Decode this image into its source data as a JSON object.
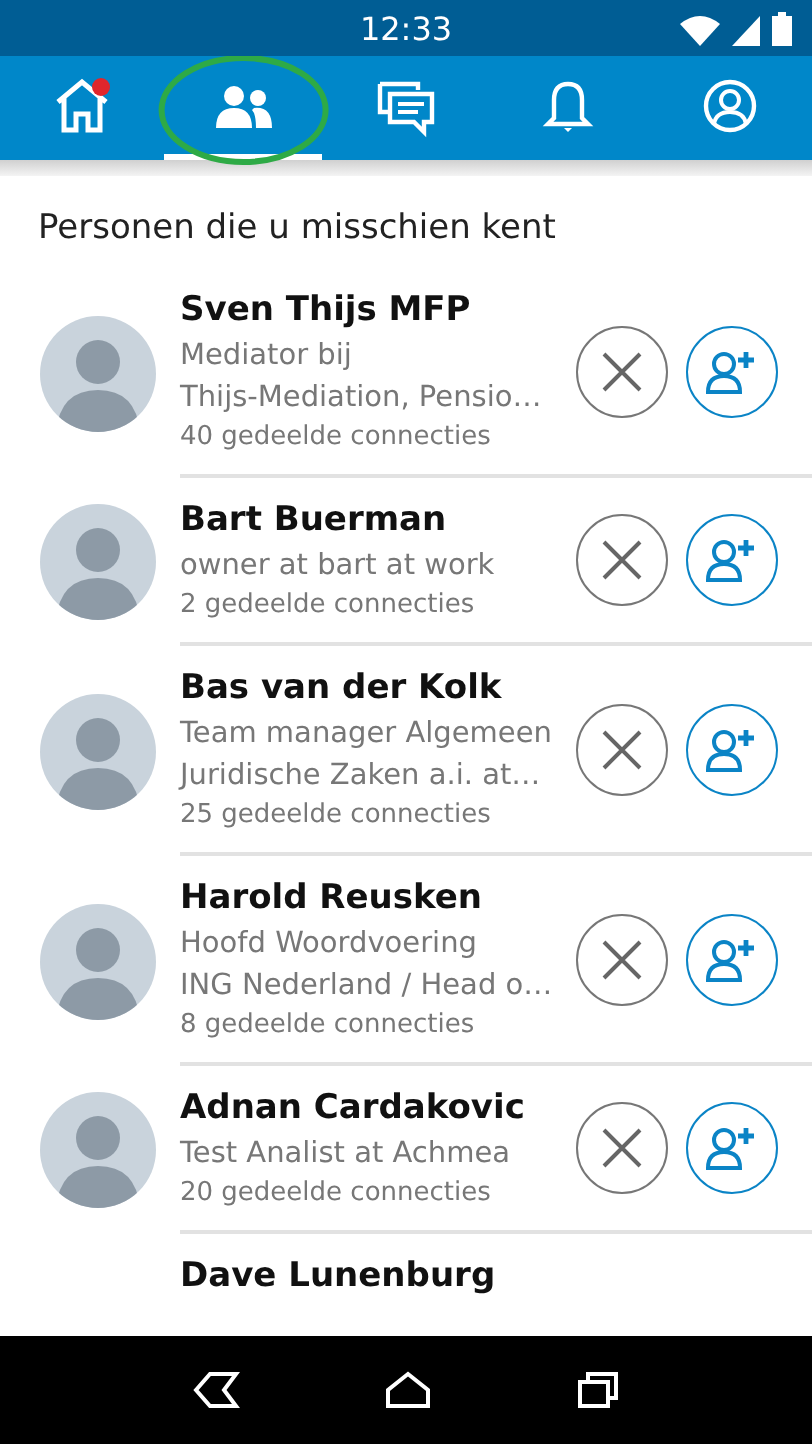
{
  "status_bar": {
    "time": "12:33"
  },
  "tabs": [
    {
      "kind": "home",
      "selected": false,
      "badge": true,
      "circled": false
    },
    {
      "kind": "people",
      "selected": true,
      "badge": false,
      "circled": true
    },
    {
      "kind": "messages",
      "selected": false,
      "badge": false,
      "circled": false
    },
    {
      "kind": "bell",
      "selected": false,
      "badge": false,
      "circled": false
    },
    {
      "kind": "profile",
      "selected": false,
      "badge": false,
      "circled": false
    }
  ],
  "heading": "Personen die u misschien kent",
  "people": [
    {
      "name": "Sven Thijs MFP",
      "headline": [
        "Mediator bij",
        "Thijs-Mediation, Pensio…"
      ],
      "connections": "40 gedeelde connecties"
    },
    {
      "name": "Bart Buerman",
      "headline": [
        "owner at bart at work"
      ],
      "connections": "2 gedeelde connecties"
    },
    {
      "name": "Bas van der Kolk",
      "headline": [
        "Team manager Algemeen",
        "Juridische Zaken a.i. at…"
      ],
      "connections": "25 gedeelde connecties"
    },
    {
      "name": "Harold Reusken",
      "headline": [
        "Hoofd Woordvoering",
        "ING Nederland / Head o…"
      ],
      "connections": "8 gedeelde connecties"
    },
    {
      "name": "Adnan Cardakovic",
      "headline": [
        "Test Analist  at Achmea"
      ],
      "connections": "20 gedeelde connecties"
    }
  ],
  "partial_person": {
    "name": "Dave Lunenburg"
  }
}
